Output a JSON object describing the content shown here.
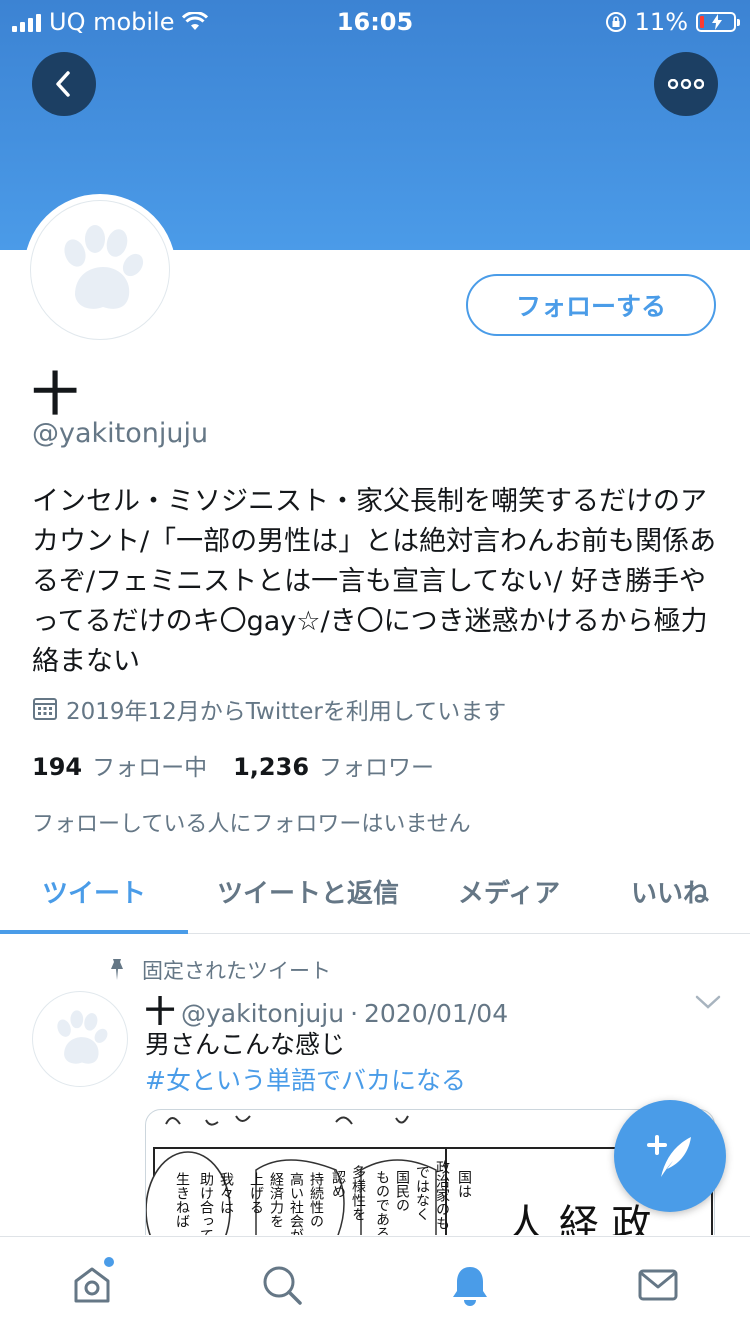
{
  "status_bar": {
    "carrier": "UQ mobile",
    "time": "16:05",
    "battery": "11%",
    "battery_level": 0.11
  },
  "header": {
    "back_icon": "back-arrow-icon",
    "more_icon": "more-dots-icon"
  },
  "profile": {
    "follow_label": "フォローする",
    "display_name": "十",
    "handle": "@yakitonjuju",
    "bio": "インセル・ミソジニスト・家父長制を嘲笑するだけのアカウント/「一部の男性は」とは絶対言わんお前も関係あるぞ/フェミニストとは一言も宣言してない/ 好き勝手やってるだけのキ〇gay☆/き〇につき迷惑かけるから極力絡まない",
    "joined": "2019年12月からTwitterを利用しています",
    "following_count": "194",
    "following_label": "フォロー中",
    "followers_count": "1,236",
    "followers_label": "フォロワー",
    "no_mutual": "フォローしている人にフォロワーはいません"
  },
  "tabs": [
    {
      "label": "ツイート",
      "active": true
    },
    {
      "label": "ツイートと返信",
      "active": false
    },
    {
      "label": "メディア",
      "active": false
    },
    {
      "label": "いいね",
      "active": false
    }
  ],
  "tweet": {
    "pinned_label": "固定されたツイート",
    "name": "十",
    "handle": "@yakitonjuju",
    "separator": "·",
    "date": "2020/01/04",
    "text": "男さんこんな感じ",
    "hashtag": "#女という単語でバカになる",
    "media_text": {
      "col1": "国は",
      "col2": "政治家のも",
      "col3": "ではなく",
      "col4": "国民の",
      "col5": "ものである",
      "col6": "多様性を",
      "col7": "認め",
      "col8": "持続性の",
      "col9": "高い社会が",
      "col10": "経済力を",
      "col11": "上げる",
      "col12": "我々は",
      "col13": "助け合って",
      "col14": "生きねば",
      "big_text": "人 経 政"
    }
  },
  "colors": {
    "accent": "#4a9ce8",
    "banner": "#4b9be8",
    "button_dark": "#1c3f63"
  },
  "bottom_nav": [
    "home-icon",
    "search-icon",
    "notifications-icon",
    "messages-icon"
  ]
}
